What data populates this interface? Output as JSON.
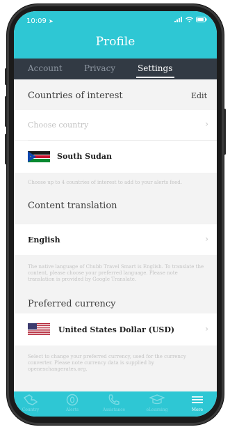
{
  "status": {
    "time": "10:09"
  },
  "header": {
    "title": "Profile"
  },
  "tabs": [
    {
      "label": "Account"
    },
    {
      "label": "Privacy"
    },
    {
      "label": "Settings",
      "active": true
    }
  ],
  "countries": {
    "heading": "Countries of interest",
    "edit_label": "Edit",
    "choose_placeholder": "Choose country",
    "selected_country": "South Sudan",
    "note": "Choose up to 4 countries of interest to add to your alerts feed."
  },
  "translation": {
    "heading": "Content translation",
    "language": "English",
    "note": "The native language of Chubb Travel Smart is English. To translate the content, please choose your preferred language. Please note translation is provided by Google Translate."
  },
  "currency": {
    "heading": "Preferred currency",
    "value": "United States Dollar (USD)",
    "note": "Select to change your preferred currency, used for the currency converter. Please note currency data is supplied by openexchangerates.org."
  },
  "tabbar": {
    "items": [
      {
        "label": "Country",
        "icon": "country-icon"
      },
      {
        "label": "Alerts",
        "icon": "alerts-icon"
      },
      {
        "label": "Assistance",
        "icon": "phone-icon"
      },
      {
        "label": "eLearning",
        "icon": "graduation-cap-icon"
      },
      {
        "label": "More",
        "icon": "menu-icon",
        "active": true
      }
    ]
  },
  "colors": {
    "accent": "#2ec7d4",
    "tabs_bg": "#323a44"
  }
}
